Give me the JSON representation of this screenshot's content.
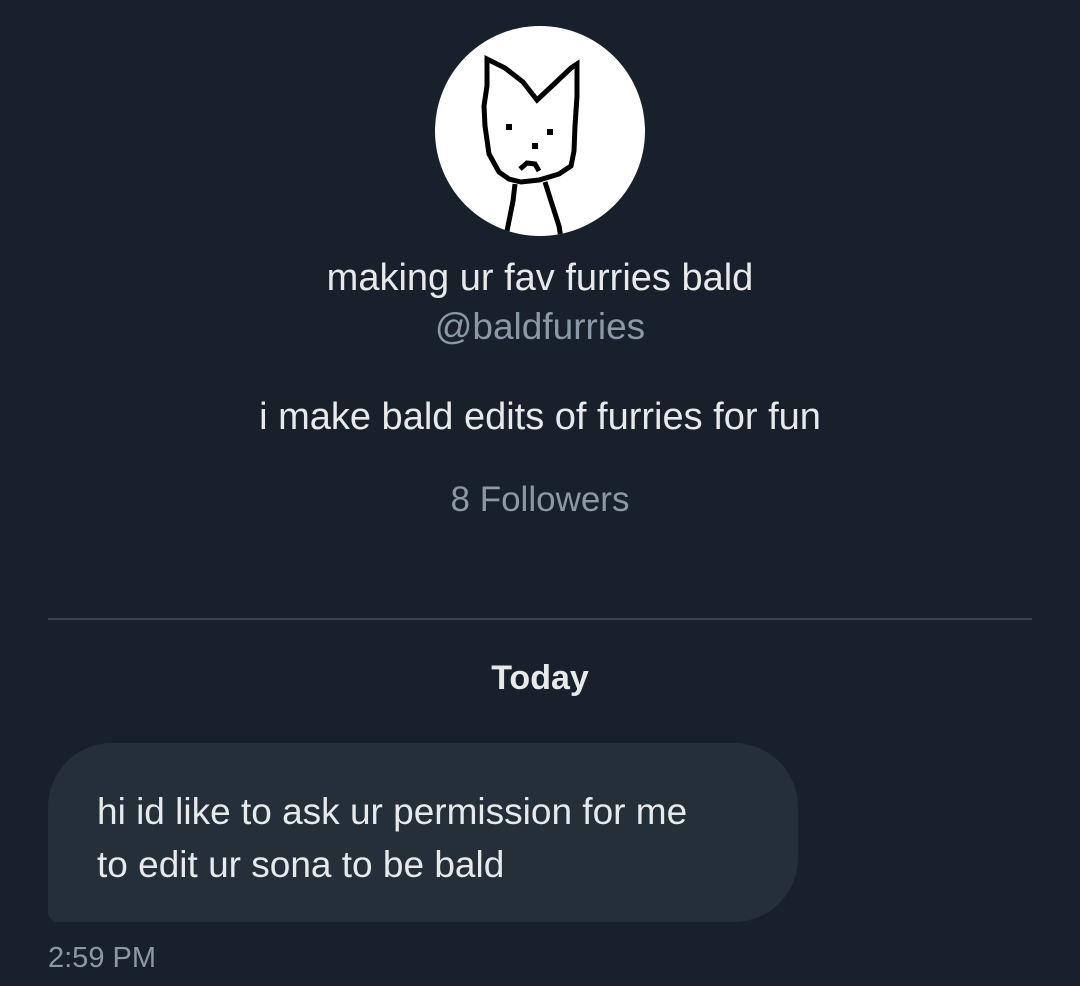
{
  "profile": {
    "avatar_icon": "cat-doodle-avatar-icon",
    "display_name": "making ur fav furries bald",
    "handle": "@baldfurries",
    "bio": "i make bald edits of furries for fun",
    "followers": "8 Followers"
  },
  "conversation": {
    "date_header": "Today",
    "messages": [
      {
        "text": "hi id like to ask ur permission for me\nto edit ur sona to be bald",
        "time": "2:59 PM"
      }
    ]
  },
  "colors": {
    "background": "#17202b",
    "bubble": "#252f39",
    "primary_text": "#e7e9ea",
    "secondary_text": "#8b98a5",
    "divider": "#38444d"
  }
}
